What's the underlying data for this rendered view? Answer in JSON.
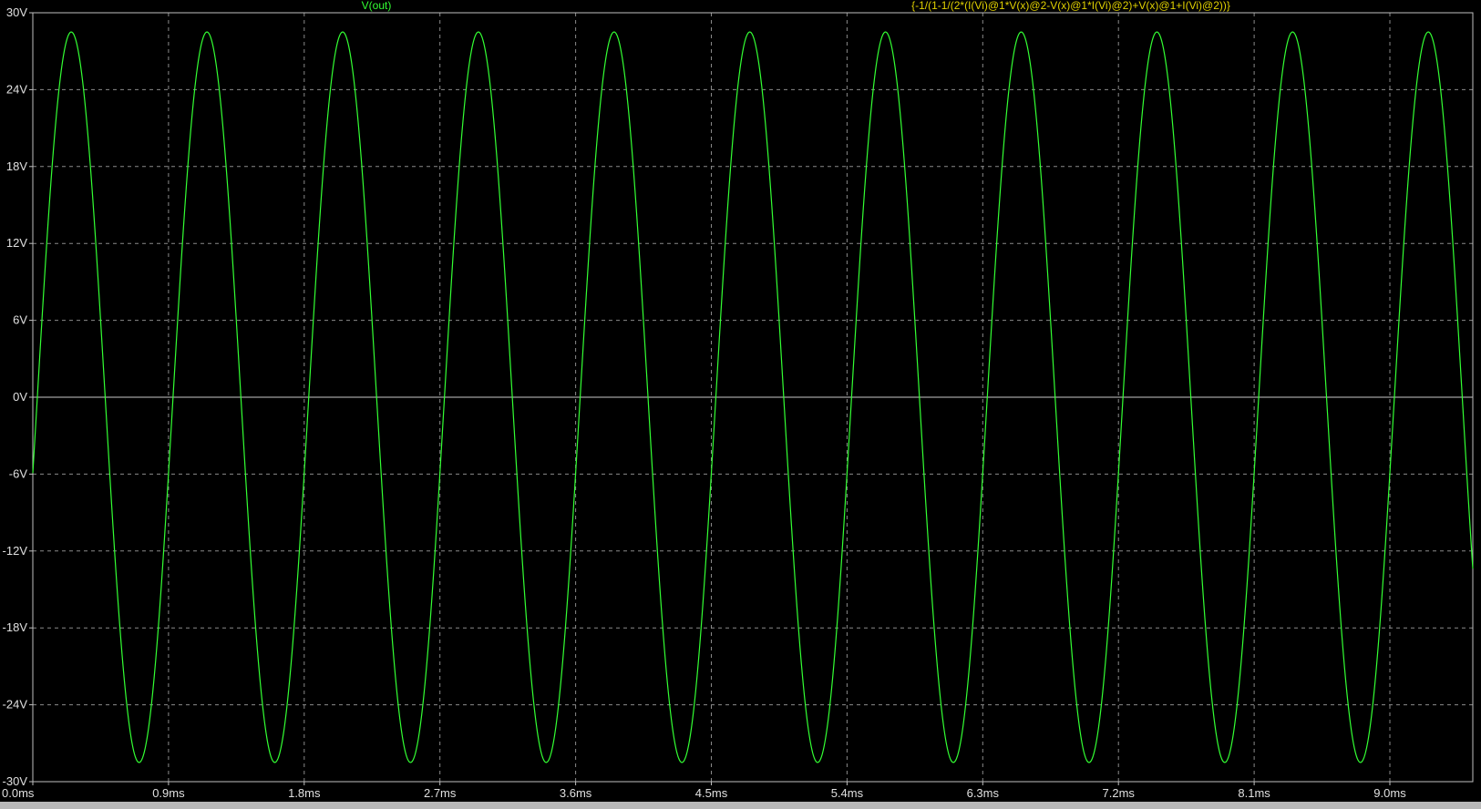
{
  "window": {
    "background_color": "#000000",
    "axis_color": "#bfbfbf",
    "grid_color": "#8a8a8a",
    "tick_label_color": "#e0e0e0",
    "zero_line_color": "#c8c8c8",
    "bottom_strip_color": "#b8b8b8"
  },
  "chart_data": {
    "type": "line",
    "x_tick_labels": [
      "0.0ms",
      "0.9ms",
      "1.8ms",
      "2.7ms",
      "3.6ms",
      "4.5ms",
      "5.4ms",
      "6.3ms",
      "7.2ms",
      "8.1ms",
      "9.0ms"
    ],
    "y_tick_labels": [
      "30V",
      "24V",
      "18V",
      "12V",
      "6V",
      "0V",
      "-6V",
      "-12V",
      "-18V",
      "-24V",
      "-30V"
    ],
    "x_ticks_ms": [
      0.0,
      0.9,
      1.8,
      2.7,
      3.6,
      4.5,
      5.4,
      6.3,
      7.2,
      8.1,
      9.0
    ],
    "y_ticks_v": [
      30,
      24,
      18,
      12,
      6,
      0,
      -6,
      -12,
      -18,
      -24,
      -30
    ],
    "xlim_ms": [
      0.0,
      9.55
    ],
    "ylim_v": [
      -30,
      30
    ],
    "grid": true,
    "series": [
      {
        "name": "V(out)",
        "color": "#33ff33",
        "waveform": "sine",
        "amplitude_v": 28.5,
        "period_ms": 0.9,
        "phase_deg": -12,
        "x_start_ms": 0.0,
        "x_end_ms": 9.55
      }
    ],
    "annotations": [
      {
        "text": "{-1/(1-1/(2*(I(Vi)@1*V(x)@2-V(x)@1*I(Vi)@2)+V(x)@1+I(Vi)@2))}",
        "color": "#e0d000"
      }
    ]
  }
}
